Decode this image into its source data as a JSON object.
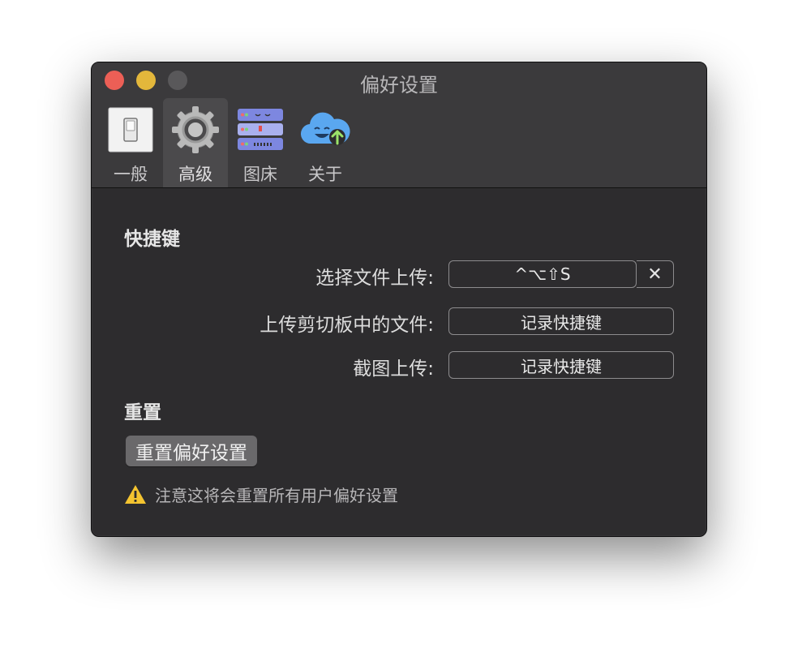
{
  "window": {
    "title": "偏好设置"
  },
  "toolbar": {
    "tabs": [
      {
        "label": "一般",
        "icon": "switch-icon"
      },
      {
        "label": "高级",
        "icon": "gear-icon",
        "active": true
      },
      {
        "label": "图床",
        "icon": "server-icon"
      },
      {
        "label": "关于",
        "icon": "cloud-upload-icon"
      }
    ]
  },
  "shortcuts": {
    "heading": "快捷键",
    "rows": [
      {
        "label": "选择文件上传:",
        "value": "^⌥⇧S",
        "clear": "✕"
      },
      {
        "label": "上传剪切板中的文件:",
        "value": "记录快捷键"
      },
      {
        "label": "截图上传:",
        "value": "记录快捷键"
      }
    ]
  },
  "reset": {
    "heading": "重置",
    "button_label": "重置偏好设置",
    "warning": "注意这将会重置所有用户偏好设置"
  },
  "colors": {
    "close": "#ec5f56",
    "minimize": "#e3b73b",
    "maximize": "#59585a",
    "warning": "#f4c430"
  }
}
